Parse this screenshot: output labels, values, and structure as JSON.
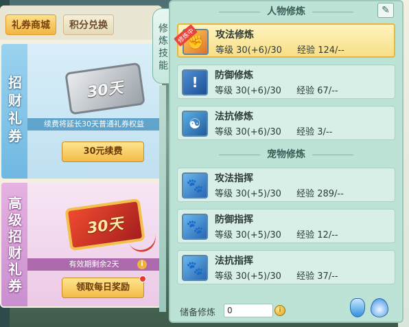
{
  "shop": {
    "tabs": [
      {
        "label": "礼券商城",
        "active": true
      },
      {
        "label": "积分兑换",
        "active": false
      }
    ],
    "card1": {
      "side_title": [
        "招",
        "财",
        "礼",
        "券"
      ],
      "ticket_text": "30天",
      "caption": "续费将延长30天普通礼券权益",
      "button": "30元续费"
    },
    "card2": {
      "side_title": [
        "高",
        "级",
        "招",
        "财",
        "礼",
        "券"
      ],
      "ticket_text": "30天",
      "caption": "有效期剩余2天",
      "info_icon": "i",
      "button": "领取每日奖励"
    }
  },
  "vertical_tab": {
    "label": [
      "修",
      "炼",
      "技",
      "能"
    ]
  },
  "cultivation": {
    "section1_title": "人物修炼",
    "section2_title": "宠物修炼",
    "edit_icon": "✎",
    "badge_cultivating": "修炼中",
    "person_skills": [
      {
        "name": "攻法修炼",
        "level_label": "等级",
        "level": "30(+6)/30",
        "exp_label": "经验",
        "exp": "124/--",
        "icon": "fist-icon",
        "selected": true
      },
      {
        "name": "防御修炼",
        "level_label": "等级",
        "level": "30(+6)/30",
        "exp_label": "经验",
        "exp": "67/--",
        "icon": "shield-exclaim-icon",
        "selected": false
      },
      {
        "name": "法抗修炼",
        "level_label": "等级",
        "level": "30(+6)/30",
        "exp_label": "经验",
        "exp": "3/--",
        "icon": "yinyang-shield-icon",
        "selected": false
      }
    ],
    "pet_skills": [
      {
        "name": "攻法指挥",
        "level_label": "等级",
        "level": "30(+5)/30",
        "exp_label": "经验",
        "exp": "289/--",
        "icon": "paw-attack-icon",
        "selected": false
      },
      {
        "name": "防御指挥",
        "level_label": "等级",
        "level": "30(+5)/30",
        "exp_label": "经验",
        "exp": "12/--",
        "icon": "paw-shield-icon",
        "selected": false
      },
      {
        "name": "法抗指挥",
        "level_label": "等级",
        "level": "30(+5)/30",
        "exp_label": "经验",
        "exp": "37/--",
        "icon": "paw-resist-icon",
        "selected": false
      }
    ],
    "reserve_label": "储备修炼",
    "reserve_value": "0",
    "coin_icon": "i"
  },
  "colors": {
    "panel_bg": "#bde3d7",
    "selected_row": "#f7df86",
    "gold_button": "#f4bb48"
  }
}
